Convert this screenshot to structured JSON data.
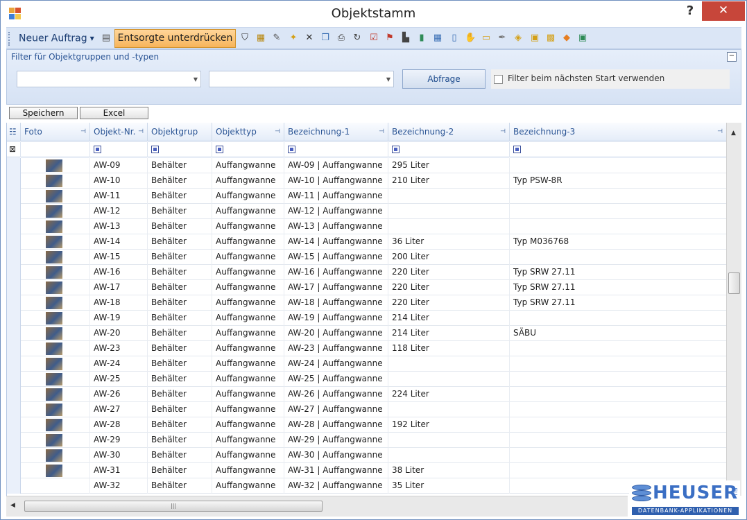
{
  "window": {
    "title": "Objektstamm",
    "help_label": "?",
    "close_label": "✕"
  },
  "toolbar": {
    "new_order_label": "Neuer Auftrag",
    "suppress_disposed_label": "Entsorgte unterdrücken",
    "icons": [
      "filter-icon",
      "new-record-icon",
      "edit-icon",
      "new-document-icon",
      "delete-icon",
      "copy-icon",
      "print-icon",
      "refresh-icon",
      "checklist-icon",
      "flag-icon",
      "ruler-icon",
      "book-icon",
      "calendar-icon",
      "manual-icon",
      "hand-icon",
      "folder-open-icon",
      "pin-tool-icon",
      "tag-icon",
      "paste-icon",
      "lock-icon",
      "navigate-icon",
      "export-icon"
    ]
  },
  "filter": {
    "label": "Filter für Objektgruppen und -typen",
    "group_value": "",
    "type_value": "",
    "query_button": "Abfrage",
    "remember_label": "Filter beim nächsten Start verwenden",
    "remember_checked": false,
    "collapse_label": "−"
  },
  "actions": {
    "save_label": "Speichern",
    "excel_label": "Excel"
  },
  "grid": {
    "columns": [
      "Foto",
      "Objekt-Nr.",
      "Objektgrup",
      "Objekttyp",
      "Bezeichnung-1",
      "Bezeichnung-2",
      "Bezeichnung-3"
    ],
    "rows": [
      {
        "photo": true,
        "nr": "AW-09",
        "group": "Behälter",
        "type": "Auffangwanne",
        "bez1": "AW-09 | Auffangwanne",
        "bez2": "295 Liter",
        "bez3": ""
      },
      {
        "photo": true,
        "nr": "AW-10",
        "group": "Behälter",
        "type": "Auffangwanne",
        "bez1": "AW-10 | Auffangwanne",
        "bez2": "210 Liter",
        "bez3": "Typ PSW-8R"
      },
      {
        "photo": true,
        "nr": "AW-11",
        "group": "Behälter",
        "type": "Auffangwanne",
        "bez1": "AW-11 | Auffangwanne",
        "bez2": "",
        "bez3": ""
      },
      {
        "photo": true,
        "nr": "AW-12",
        "group": "Behälter",
        "type": "Auffangwanne",
        "bez1": "AW-12 | Auffangwanne",
        "bez2": "",
        "bez3": ""
      },
      {
        "photo": true,
        "nr": "AW-13",
        "group": "Behälter",
        "type": "Auffangwanne",
        "bez1": "AW-13 | Auffangwanne",
        "bez2": "",
        "bez3": ""
      },
      {
        "photo": true,
        "nr": "AW-14",
        "group": "Behälter",
        "type": "Auffangwanne",
        "bez1": "AW-14 | Auffangwanne",
        "bez2": "36 Liter",
        "bez3": "Typ M036768"
      },
      {
        "photo": true,
        "nr": "AW-15",
        "group": "Behälter",
        "type": "Auffangwanne",
        "bez1": "AW-15 | Auffangwanne",
        "bez2": "200 Liter",
        "bez3": ""
      },
      {
        "photo": true,
        "nr": "AW-16",
        "group": "Behälter",
        "type": "Auffangwanne",
        "bez1": "AW-16 | Auffangwanne",
        "bez2": "220 Liter",
        "bez3": "Typ SRW 27.11"
      },
      {
        "photo": true,
        "nr": "AW-17",
        "group": "Behälter",
        "type": "Auffangwanne",
        "bez1": "AW-17 | Auffangwanne",
        "bez2": "220 Liter",
        "bez3": "Typ SRW 27.11"
      },
      {
        "photo": true,
        "nr": "AW-18",
        "group": "Behälter",
        "type": "Auffangwanne",
        "bez1": "AW-18 | Auffangwanne",
        "bez2": "220 Liter",
        "bez3": "Typ SRW 27.11"
      },
      {
        "photo": true,
        "nr": "AW-19",
        "group": "Behälter",
        "type": "Auffangwanne",
        "bez1": "AW-19 | Auffangwanne",
        "bez2": "214 Liter",
        "bez3": ""
      },
      {
        "photo": true,
        "nr": "AW-20",
        "group": "Behälter",
        "type": "Auffangwanne",
        "bez1": "AW-20 | Auffangwanne",
        "bez2": "214 Liter",
        "bez3": "SÄBU"
      },
      {
        "photo": true,
        "nr": "AW-23",
        "group": "Behälter",
        "type": "Auffangwanne",
        "bez1": "AW-23 | Auffangwanne",
        "bez2": "118 Liter",
        "bez3": ""
      },
      {
        "photo": true,
        "nr": "AW-24",
        "group": "Behälter",
        "type": "Auffangwanne",
        "bez1": "AW-24 | Auffangwanne",
        "bez2": "",
        "bez3": ""
      },
      {
        "photo": true,
        "nr": "AW-25",
        "group": "Behälter",
        "type": "Auffangwanne",
        "bez1": "AW-25 | Auffangwanne",
        "bez2": "",
        "bez3": ""
      },
      {
        "photo": true,
        "nr": "AW-26",
        "group": "Behälter",
        "type": "Auffangwanne",
        "bez1": "AW-26 | Auffangwanne",
        "bez2": "224 Liter",
        "bez3": ""
      },
      {
        "photo": true,
        "nr": "AW-27",
        "group": "Behälter",
        "type": "Auffangwanne",
        "bez1": "AW-27 | Auffangwanne",
        "bez2": "",
        "bez3": ""
      },
      {
        "photo": true,
        "nr": "AW-28",
        "group": "Behälter",
        "type": "Auffangwanne",
        "bez1": "AW-28 | Auffangwanne",
        "bez2": "192 Liter",
        "bez3": ""
      },
      {
        "photo": true,
        "nr": "AW-29",
        "group": "Behälter",
        "type": "Auffangwanne",
        "bez1": "AW-29 | Auffangwanne",
        "bez2": "",
        "bez3": ""
      },
      {
        "photo": true,
        "nr": "AW-30",
        "group": "Behälter",
        "type": "Auffangwanne",
        "bez1": "AW-30 | Auffangwanne",
        "bez2": "",
        "bez3": ""
      },
      {
        "photo": true,
        "nr": "AW-31",
        "group": "Behälter",
        "type": "Auffangwanne",
        "bez1": "AW-31 | Auffangwanne",
        "bez2": "38 Liter",
        "bez3": ""
      },
      {
        "photo": false,
        "nr": "AW-32",
        "group": "Behälter",
        "type": "Auffangwanne",
        "bez1": "AW-32 | Auffangwanne",
        "bez2": "35 Liter",
        "bez3": ""
      }
    ]
  },
  "logo": {
    "name": "HEUSER",
    "suffix": ".EU",
    "tagline": "DATENBANK-APPLIKATIONEN"
  },
  "colors": {
    "accent": "#2b5595",
    "highlight_button": "#f7b45a",
    "close": "#c7463a"
  }
}
